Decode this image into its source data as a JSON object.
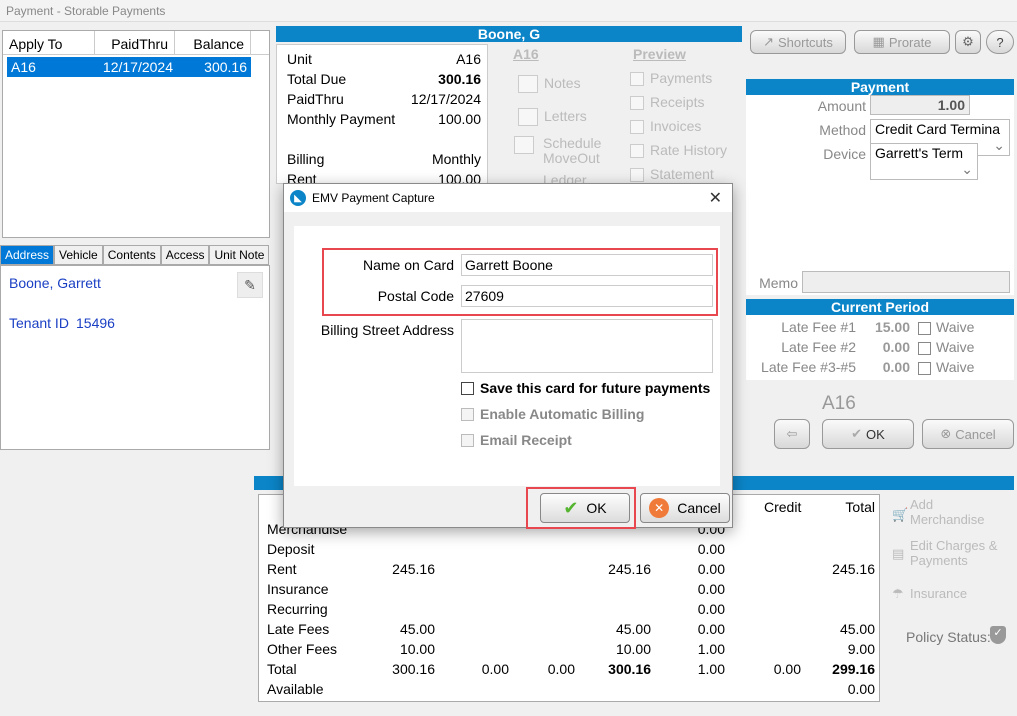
{
  "window": {
    "title": "Payment - Storable Payments"
  },
  "apply": {
    "headers": [
      "Apply To",
      "PaidThru",
      "Balance"
    ],
    "row": {
      "unit": "A16",
      "paid_thru": "12/17/2024",
      "balance": "300.16"
    }
  },
  "tabs": [
    "Address",
    "Vehicle",
    "Contents",
    "Access",
    "Unit Note"
  ],
  "address": {
    "name": "Boone, Garrett",
    "tenant_id_label": "Tenant ID",
    "tenant_id": "15496"
  },
  "tenant_header": "Boone, G",
  "unit_info": [
    {
      "label": "Unit",
      "value": "A16"
    },
    {
      "label": "Total Due",
      "value": "300.16"
    },
    {
      "label": "PaidThru",
      "value": "12/17/2024"
    },
    {
      "label": "Monthly Payment",
      "value": "100.00"
    },
    {
      "label": "",
      "value": ""
    },
    {
      "label": "Billing",
      "value": "Monthly"
    },
    {
      "label": "Rent",
      "value": "100.00"
    }
  ],
  "actions": {
    "unit_link": "A16",
    "notes": "Notes",
    "letters": "Letters",
    "schedule": "Schedule",
    "moveout": "MoveOut",
    "ledger": "Ledger"
  },
  "preview": {
    "title": "Preview",
    "items": [
      "Payments",
      "Receipts",
      "Invoices",
      "Rate History",
      "Statement"
    ]
  },
  "toolbar": {
    "shortcuts": "Shortcuts",
    "prorate": "Prorate"
  },
  "payment": {
    "header": "Payment",
    "amount_label": "Amount",
    "amount": "1.00",
    "method_label": "Method",
    "method": "Credit Card Termina",
    "device_label": "Device",
    "device": "Garrett's Term",
    "memo_label": "Memo"
  },
  "current_period": {
    "header": "Current Period",
    "rows": [
      {
        "label": "Late Fee #1",
        "value": "15.00",
        "waive": "Waive"
      },
      {
        "label": "Late Fee #2",
        "value": "0.00",
        "waive": "Waive"
      },
      {
        "label": "Late Fee #3-#5",
        "value": "0.00",
        "waive": "Waive"
      }
    ]
  },
  "unit_big": "A16",
  "main_ok": "OK",
  "main_cancel": "Cancel",
  "grid": {
    "headers": {
      "credit": "Credit",
      "total": "Total"
    },
    "rows": [
      {
        "label": "Merchandise",
        "c1": "",
        "c2": "",
        "c3": "",
        "c4": "",
        "c5": "0.00",
        "c6": "",
        "c7": ""
      },
      {
        "label": "Deposit",
        "c1": "",
        "c2": "",
        "c3": "",
        "c4": "",
        "c5": "0.00",
        "c6": "",
        "c7": ""
      },
      {
        "label": "Rent",
        "c1": "245.16",
        "c2": "",
        "c3": "",
        "c4": "245.16",
        "c5": "0.00",
        "c6": "",
        "c7": "245.16"
      },
      {
        "label": "Insurance",
        "c1": "",
        "c2": "",
        "c3": "",
        "c4": "",
        "c5": "0.00",
        "c6": "",
        "c7": ""
      },
      {
        "label": "Recurring",
        "c1": "",
        "c2": "",
        "c3": "",
        "c4": "",
        "c5": "0.00",
        "c6": "",
        "c7": ""
      },
      {
        "label": "Late Fees",
        "c1": "45.00",
        "c2": "",
        "c3": "",
        "c4": "45.00",
        "c5": "0.00",
        "c6": "",
        "c7": "45.00"
      },
      {
        "label": "Other Fees",
        "c1": "10.00",
        "c2": "",
        "c3": "",
        "c4": "10.00",
        "c5": "1.00",
        "c6": "",
        "c7": "9.00"
      },
      {
        "label": "Total",
        "c1": "300.16",
        "c2": "0.00",
        "c3": "0.00",
        "c4": "300.16",
        "c5": "1.00",
        "c6": "0.00",
        "c7": "299.16"
      },
      {
        "label": "Available",
        "c1": "",
        "c2": "",
        "c3": "",
        "c4": "",
        "c5": "",
        "c6": "",
        "c7": "0.00"
      }
    ]
  },
  "right_actions": {
    "add": "Add",
    "merch": "Merchandise",
    "edit": "Edit Charges &",
    "payments": "Payments",
    "insurance": "Insurance",
    "policy": "Policy Status:"
  },
  "dialog": {
    "title": "EMV Payment Capture",
    "name_label": "Name on Card",
    "name_value": "Garrett Boone",
    "postal_label": "Postal Code",
    "postal_value": "27609",
    "street_label": "Billing Street Address",
    "save_card": "Save this card for future payments",
    "auto_billing": "Enable Automatic Billing",
    "email_receipt": "Email Receipt",
    "ok": "OK",
    "cancel": "Cancel"
  }
}
